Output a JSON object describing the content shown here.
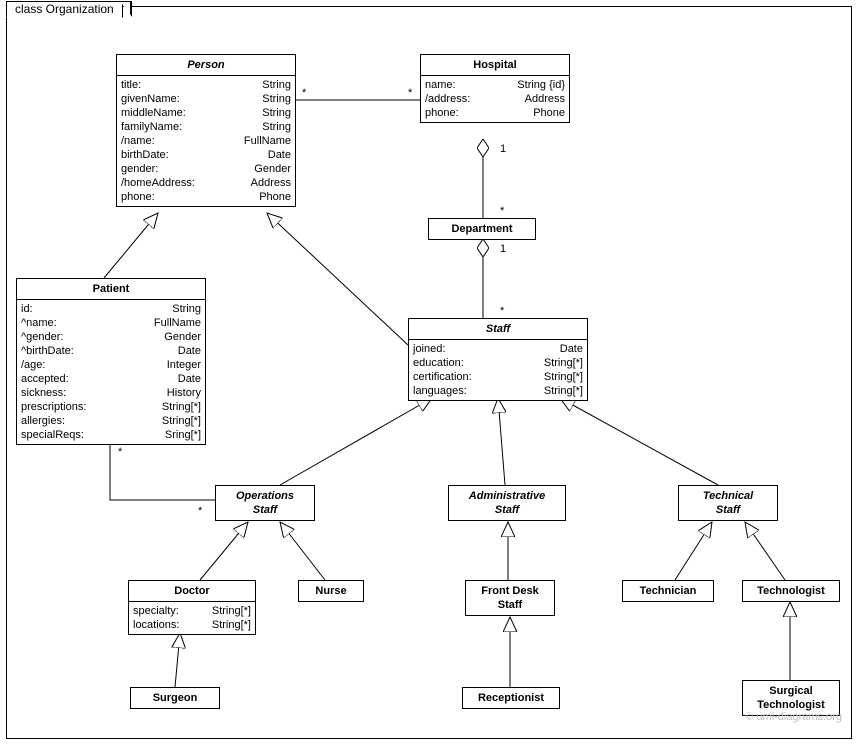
{
  "frame": {
    "title": "class Organization"
  },
  "classes": {
    "person": {
      "name": "Person",
      "attrs": [
        {
          "n": "title:",
          "t": "String"
        },
        {
          "n": "givenName:",
          "t": "String"
        },
        {
          "n": "middleName:",
          "t": "String"
        },
        {
          "n": "familyName:",
          "t": "String"
        },
        {
          "n": "/name:",
          "t": "FullName"
        },
        {
          "n": "birthDate:",
          "t": "Date"
        },
        {
          "n": "gender:",
          "t": "Gender"
        },
        {
          "n": "/homeAddress:",
          "t": "Address"
        },
        {
          "n": "phone:",
          "t": "Phone"
        }
      ]
    },
    "hospital": {
      "name": "Hospital",
      "attrs": [
        {
          "n": "name:",
          "t": "String {id}"
        },
        {
          "n": "/address:",
          "t": "Address"
        },
        {
          "n": "phone:",
          "t": "Phone"
        }
      ]
    },
    "department": {
      "name": "Department"
    },
    "patient": {
      "name": "Patient",
      "attrs": [
        {
          "n": "id:",
          "t": "String"
        },
        {
          "n": "^name:",
          "t": "FullName"
        },
        {
          "n": "^gender:",
          "t": "Gender"
        },
        {
          "n": "^birthDate:",
          "t": "Date"
        },
        {
          "n": "/age:",
          "t": "Integer"
        },
        {
          "n": "accepted:",
          "t": "Date"
        },
        {
          "n": "sickness:",
          "t": "History"
        },
        {
          "n": "prescriptions:",
          "t": "String[*]"
        },
        {
          "n": "allergies:",
          "t": "String[*]"
        },
        {
          "n": "specialReqs:",
          "t": "Sring[*]"
        }
      ]
    },
    "staff": {
      "name": "Staff",
      "attrs": [
        {
          "n": "joined:",
          "t": "Date"
        },
        {
          "n": "education:",
          "t": "String[*]"
        },
        {
          "n": "certification:",
          "t": "String[*]"
        },
        {
          "n": "languages:",
          "t": "String[*]"
        }
      ]
    },
    "opstaff": {
      "name": "Operations",
      "name2": "Staff"
    },
    "admstaff": {
      "name": "Administrative",
      "name2": "Staff"
    },
    "techstaff": {
      "name": "Technical",
      "name2": "Staff"
    },
    "doctor": {
      "name": "Doctor",
      "attrs": [
        {
          "n": "specialty:",
          "t": "String[*]"
        },
        {
          "n": "locations:",
          "t": "String[*]"
        }
      ]
    },
    "nurse": {
      "name": "Nurse"
    },
    "frontdesk": {
      "name": "Front Desk",
      "name2": "Staff"
    },
    "technician": {
      "name": "Technician"
    },
    "technologist": {
      "name": "Technologist"
    },
    "surgeon": {
      "name": "Surgeon"
    },
    "receptionist": {
      "name": "Receptionist"
    },
    "surgtech": {
      "name": "Surgical",
      "name2": "Technologist"
    }
  },
  "multiplicities": {
    "person_hospital_left": "*",
    "person_hospital_right": "*",
    "hospital_department_top": "1",
    "hospital_department_bottom": "*",
    "department_staff_top": "1",
    "department_staff_bottom": "*",
    "patient_opstaff_patient": "*",
    "patient_opstaff_op": "*"
  },
  "watermark": "© uml-diagrams.org"
}
